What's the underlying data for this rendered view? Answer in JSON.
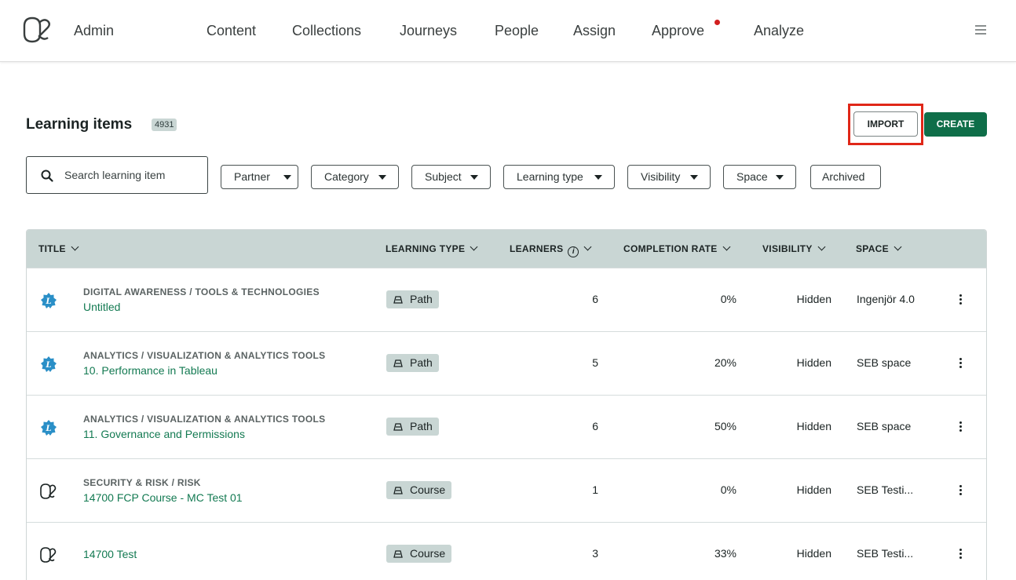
{
  "nav": {
    "brand": "Admin",
    "items": [
      "Content",
      "Collections",
      "Journeys",
      "People",
      "Assign",
      "Approve",
      "Analyze"
    ]
  },
  "header": {
    "title": "Learning items",
    "count": "4931",
    "import_label": "IMPORT",
    "create_label": "CREATE"
  },
  "search": {
    "placeholder": "Search learning item",
    "value": ""
  },
  "filters": [
    "Partner",
    "Category",
    "Subject",
    "Learning type",
    "Visibility",
    "Space",
    "Archived"
  ],
  "table": {
    "columns": [
      "TITLE",
      "LEARNING TYPE",
      "LEARNERS",
      "COMPLETION RATE",
      "VISIBILITY",
      "SPACE"
    ],
    "rows": [
      {
        "icon": "partner-badge-icon",
        "category": "DIGITAL AWARENESS / TOOLS & TECHNOLOGIES",
        "title": "Untitled",
        "type": "Path",
        "learners": "6",
        "rate": "0%",
        "visibility": "Hidden",
        "space": "Ingenjör 4.0"
      },
      {
        "icon": "partner-badge-icon",
        "category": "ANALYTICS / VISUALIZATION & ANALYTICS TOOLS",
        "title": "10. Performance in Tableau",
        "type": "Path",
        "learners": "5",
        "rate": "20%",
        "visibility": "Hidden",
        "space": "SEB space"
      },
      {
        "icon": "partner-badge-icon",
        "category": "ANALYTICS / VISUALIZATION & ANALYTICS TOOLS",
        "title": "11. Governance and Permissions",
        "type": "Path",
        "learners": "6",
        "rate": "50%",
        "visibility": "Hidden",
        "space": "SEB space"
      },
      {
        "icon": "brand-logo-icon",
        "category": "SECURITY & RISK / RISK",
        "title": "14700 FCP Course - MC Test 01",
        "type": "Course",
        "learners": "1",
        "rate": "0%",
        "visibility": "Hidden",
        "space": "SEB Testi..."
      },
      {
        "icon": "brand-logo-icon",
        "category": "",
        "title": "14700 Test",
        "type": "Course",
        "learners": "3",
        "rate": "33%",
        "visibility": "Hidden",
        "space": "SEB Testi..."
      }
    ]
  },
  "colors": {
    "accent_green": "#0f6e49",
    "link_green": "#137a52",
    "header_bg": "#c9d6d4",
    "highlight_red": "#e02718",
    "notification_dot": "#d21f1f"
  }
}
